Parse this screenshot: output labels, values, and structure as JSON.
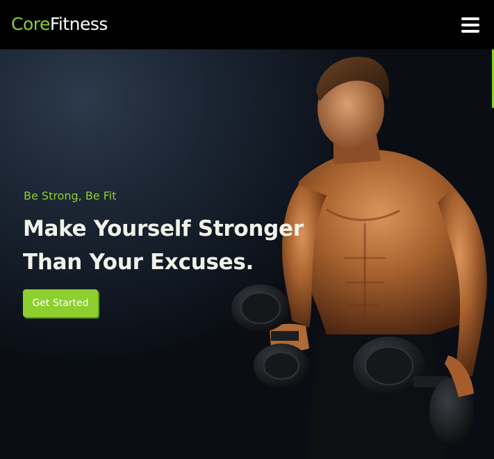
{
  "header": {
    "logo_accent": "Core",
    "logo_main": "Fitness",
    "menu_icon": "hamburger-menu-icon"
  },
  "hero": {
    "tagline": "Be Strong, Be Fit",
    "headline_line1": "Make Yourself Stronger",
    "headline_line2": "Than Your Excuses.",
    "cta_label": "Get Started",
    "image": "shirtless-man-holding-dumbbells"
  },
  "colors": {
    "accent": "#8ccf2e",
    "header_bg": "#000000",
    "hero_bg": "#151d28",
    "headline": "#f1f3ea"
  }
}
